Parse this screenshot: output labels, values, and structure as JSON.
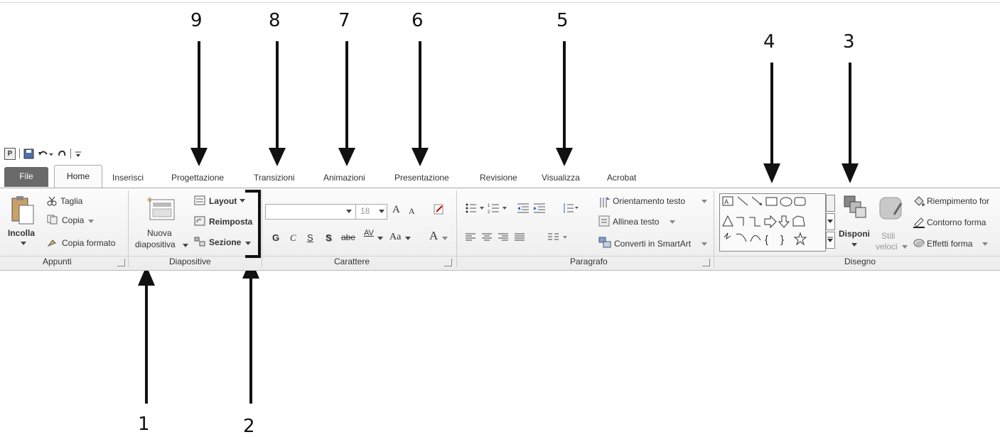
{
  "callouts": [
    "1",
    "2",
    "3",
    "4",
    "5",
    "6",
    "7",
    "8",
    "9"
  ],
  "qat": {
    "separator": "|"
  },
  "tabs": {
    "file": "File",
    "home": "Home",
    "inserisci": "Inserisci",
    "progettazione": "Progettazione",
    "transizioni": "Transizioni",
    "animazioni": "Animazioni",
    "presentazione": "Presentazione",
    "revisione": "Revisione",
    "visualizza": "Visualizza",
    "acrobat": "Acrobat"
  },
  "appunti": {
    "incolla": "Incolla",
    "taglia": "Taglia",
    "copia": "Copia",
    "copia_formato": "Copia formato",
    "group": "Appunti"
  },
  "diapositive": {
    "nuova": "Nuova",
    "diapositiva": "diapositiva",
    "layout": "Layout",
    "reimposta": "Reimposta",
    "sezione": "Sezione",
    "group": "Diapositive"
  },
  "carattere": {
    "font_size": "18",
    "grow": "A",
    "shrink": "A",
    "bold": "G",
    "italic": "C",
    "underline": "S",
    "shadow": "S",
    "strike": "abe",
    "spacing": "AV",
    "case": "Aa",
    "color": "A",
    "group": "Carattere"
  },
  "paragrafo": {
    "orientamento": "Orientamento testo",
    "allinea": "Allinea testo",
    "converti": "Converti in SmartArt",
    "group": "Paragrafo"
  },
  "disegno": {
    "disponi": "Disponi",
    "stili": "Stili",
    "veloci": "veloci",
    "riempimento": "Riempimento for",
    "contorno": "Contorno forma",
    "effetti": "Effetti forma",
    "group": "Disegno"
  },
  "colors": {
    "accent": "#111111",
    "file_tab": "#6a6a6a",
    "ribbon": "#f3f3f3"
  }
}
